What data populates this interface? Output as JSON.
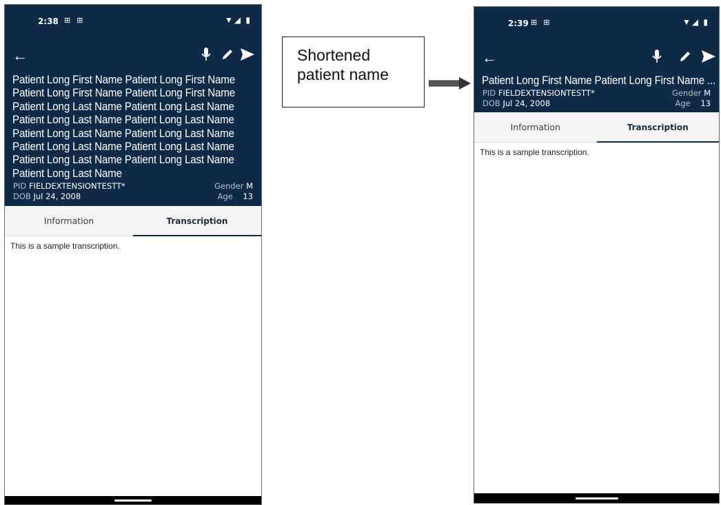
{
  "left_screen": {
    "status": {
      "time": "2:38",
      "left_icons": "⊞ ⊞",
      "right_icons": "▼◢ ▮"
    },
    "patient_name": "Patient Long First Name Patient Long First Name Patient Long First Name Patient Long First Name Patient Long Last Name Patient Long Last Name Patient Long Last Name Patient Long Last Name Patient Long Last Name Patient Long Last Name Patient Long Last Name Patient Long Last Name Patient Long Last Name Patient Long Last Name Patient Long Last Name",
    "pid_label": "PID",
    "pid_value": "FIELDEXTENSIONTESTT*",
    "gender_label": "Gender",
    "gender_value": "M",
    "dob_label": "DOB",
    "dob_value": "Jul 24, 2008",
    "age_label": "Age",
    "age_value": "13",
    "tabs": [
      "Information",
      "Transcription"
    ],
    "active_tab": "Transcription",
    "transcription": "This is a sample transcription."
  },
  "right_screen": {
    "status": {
      "time": "2:39",
      "left_icons": "⊞ ⊞",
      "right_icons": "▼◢ ▮"
    },
    "patient_name": "Patient Long First Name Patient Long First Name ...",
    "pid_label": "PID",
    "pid_value": "FIELDEXTENSIONTESTT*",
    "gender_label": "Gender",
    "gender_value": "M",
    "dob_label": "DOB",
    "dob_value": "Jul 24, 2008",
    "age_label": "Age",
    "age_value": "13",
    "tabs": [
      "Information",
      "Transcription"
    ],
    "active_tab": "Transcription",
    "transcription": "This is a sample transcription."
  },
  "callout": {
    "line1": "Shortened",
    "line2": "patient name"
  },
  "colors": {
    "header": "#0f2a47",
    "navbar": "#000000"
  },
  "icons": {
    "back": "arrow-left-icon",
    "mic": "microphone-icon",
    "edit": "pencil-icon",
    "send": "send-icon"
  }
}
